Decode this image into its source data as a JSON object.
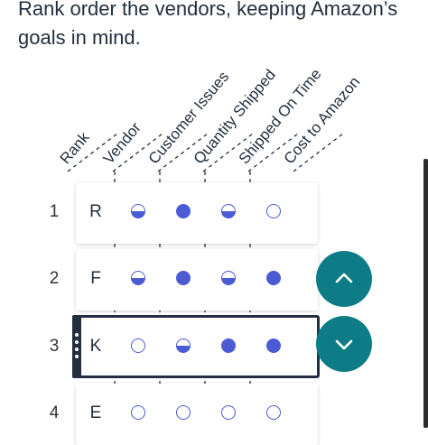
{
  "question": "Rank order the vendors, keeping Amazon’s goals in mind.",
  "columns": [
    "Rank",
    "Vendor",
    "Customer Issues",
    "Quantity Shipped",
    "Shipped On Time",
    "Cost to Amazon"
  ],
  "rows": [
    {
      "rank": "1",
      "vendor": "R",
      "ratings": [
        "half",
        "full",
        "half",
        "empty"
      ],
      "selected": false
    },
    {
      "rank": "2",
      "vendor": "F",
      "ratings": [
        "half",
        "full",
        "half",
        "full"
      ],
      "selected": false
    },
    {
      "rank": "3",
      "vendor": "K",
      "ratings": [
        "empty",
        "half",
        "full",
        "full"
      ],
      "selected": true
    },
    {
      "rank": "4",
      "vendor": "E",
      "ratings": [
        "empty",
        "empty",
        "empty",
        "empty"
      ],
      "selected": false
    }
  ],
  "controls": {
    "move_up_icon": "chevron-up-icon",
    "move_down_icon": "chevron-down-icon",
    "accent": "#0e7c86"
  },
  "rating_color": "#4a5bd4"
}
